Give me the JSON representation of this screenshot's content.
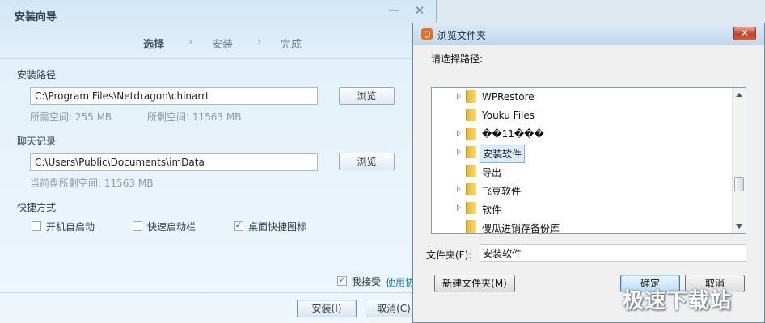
{
  "installer": {
    "title": "安装向导",
    "steps": [
      {
        "label": "选择",
        "active": true
      },
      {
        "label": "安装",
        "active": false
      },
      {
        "label": "完成",
        "active": false
      }
    ],
    "step_separator": "›",
    "install_path": {
      "section_label": "安装路径",
      "value": "C:\\Program Files\\Netdragon\\chinarrt",
      "browse_label": "浏览",
      "required_space": "所需空间: 255 MB",
      "free_space": "所剩空间: 11563 MB"
    },
    "chat_history": {
      "section_label": "聊天记录",
      "value": "C:\\Users\\Public\\Documents\\imData",
      "browse_label": "浏览",
      "free_space": "当前盘所剩空间: 11563 MB"
    },
    "shortcuts": {
      "section_label": "快捷方式",
      "options": [
        {
          "label": "开机自启动",
          "checked": false
        },
        {
          "label": "快速启动栏",
          "checked": false
        },
        {
          "label": "桌面快捷图标",
          "checked": true
        }
      ]
    },
    "agree": {
      "label": "我接受",
      "checked": true,
      "link_text": "使用协议"
    },
    "install_button": "安装(I)",
    "cancel_button": "取消(C)"
  },
  "browser": {
    "title": "浏览文件夹",
    "prompt": "请选择路径:",
    "tree": [
      {
        "label": "WPRestore",
        "expandable": true,
        "selected": false
      },
      {
        "label": "Youku Files",
        "expandable": false,
        "selected": false
      },
      {
        "label": "��11���",
        "expandable": true,
        "selected": false
      },
      {
        "label": "安装软件",
        "expandable": true,
        "selected": true
      },
      {
        "label": "导出",
        "expandable": false,
        "selected": false
      },
      {
        "label": "飞豆软件",
        "expandable": true,
        "selected": false
      },
      {
        "label": "软件",
        "expandable": true,
        "selected": false
      },
      {
        "label": "傻瓜进销存备份库",
        "expandable": false,
        "selected": false
      }
    ],
    "folder_label": "文件夹(F):",
    "folder_value": "安装软件",
    "new_folder_button": "新建文件夹(M)",
    "ok_button": "确定",
    "cancel_button": "取消"
  },
  "watermark": "极速下载站",
  "icons": {
    "minimize": "minimize-icon",
    "close": "close-icon",
    "folder": "folder-icon",
    "expand": "expand-arrow-icon",
    "app": "app-logo-icon"
  }
}
